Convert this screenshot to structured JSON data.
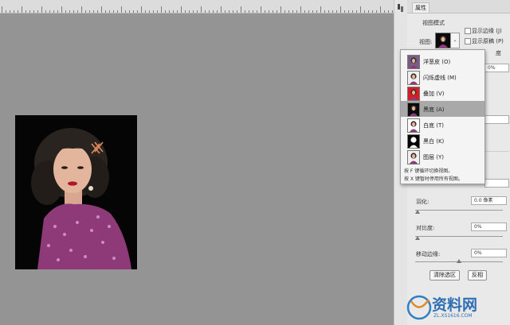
{
  "panel": {
    "tab_label": "属性",
    "view_mode_title": "视图模式",
    "view_label": "视图:",
    "show_edges": "显示边缘 (J)",
    "show_original": "显示原稿 (P)",
    "partial_label": "度",
    "partial_value": "0%",
    "feather_label": "羽化:",
    "feather_value": "0.0 像素",
    "contrast_label": "对比度:",
    "contrast_value": "0%",
    "shift_edge_label": "移动边缘:",
    "shift_edge_value": "0%",
    "clear_selection": "清除选区",
    "invert": "反相"
  },
  "view_menu": {
    "items": [
      {
        "label": "洋葱皮 (O)",
        "bg": "#7a5d86",
        "selected": false
      },
      {
        "label": "闪烁虚线 (M)",
        "bg": "#f0f0f0",
        "selected": false
      },
      {
        "label": "叠加 (V)",
        "bg": "#d81d22",
        "selected": false
      },
      {
        "label": "黑底 (A)",
        "bg": "#0a0a0a",
        "selected": true
      },
      {
        "label": "白底 (T)",
        "bg": "#ffffff",
        "selected": false
      },
      {
        "label": "黑白 (K)",
        "bg": "#000000",
        "selected": false
      },
      {
        "label": "图层 (Y)",
        "bg": "#f0f0f0",
        "selected": false
      }
    ],
    "hint1": "按 F 键循环切换视图。",
    "hint2": "按 X 键暂时停用所有视图。"
  },
  "colors": {
    "canvas": "#949494",
    "panel": "#e9e9e9",
    "menu_selected": "#a9a9a9",
    "dress": "#8e3a79"
  },
  "watermark": {
    "brand": "资料网",
    "url": "ZL.XS1616.COM"
  }
}
